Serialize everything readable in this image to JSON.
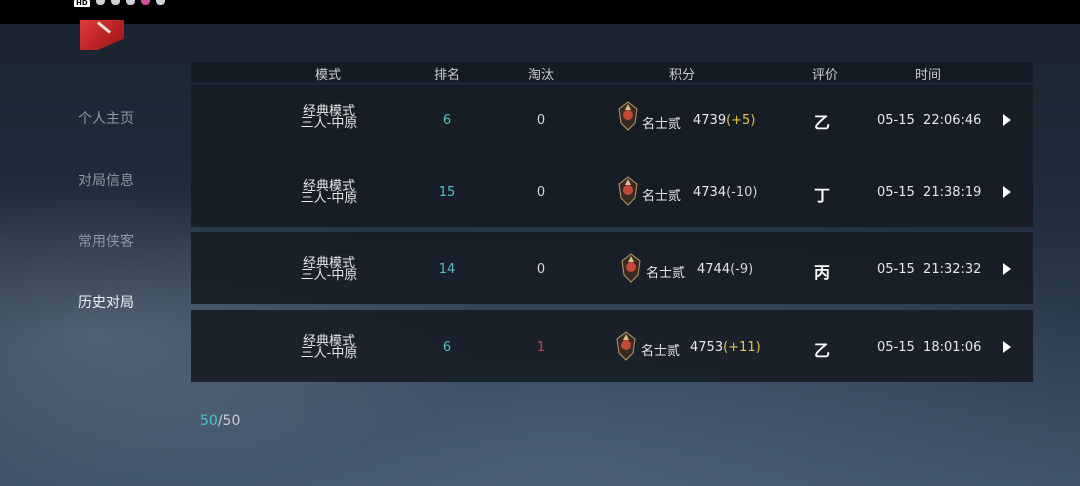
{
  "sidebar": {
    "items": [
      {
        "label": "个人主页",
        "active": false
      },
      {
        "label": "对局信息",
        "active": false
      },
      {
        "label": "常用侠客",
        "active": false
      },
      {
        "label": "历史对局",
        "active": true
      }
    ]
  },
  "table": {
    "headers": {
      "mode": "模式",
      "rank": "排名",
      "eliminations": "淘汰",
      "points": "积分",
      "rating": "评价",
      "time": "时间"
    },
    "rows": [
      {
        "mode_line1": "经典模式",
        "mode_line2": "三人-中原",
        "rank": "6",
        "eliminations": "0",
        "elim_highlight": false,
        "rank_title": "名士贰",
        "score": "4739",
        "delta": "(+5)",
        "delta_sign": "pos",
        "grade": "乙",
        "date": "05-15",
        "clock": "22:06:46"
      },
      {
        "mode_line1": "经典模式",
        "mode_line2": "三人-中原",
        "rank": "15",
        "eliminations": "0",
        "elim_highlight": false,
        "rank_title": "名士贰",
        "score": "4734",
        "delta": "(-10)",
        "delta_sign": "neg",
        "grade": "丁",
        "date": "05-15",
        "clock": "21:38:19"
      },
      {
        "mode_line1": "经典模式",
        "mode_line2": "三人-中原",
        "rank": "14",
        "eliminations": "0",
        "elim_highlight": false,
        "rank_title": "名士贰",
        "score": "4744",
        "delta": "(-9)",
        "delta_sign": "neg",
        "grade": "丙",
        "date": "05-15",
        "clock": "21:32:32"
      },
      {
        "mode_line1": "经典模式",
        "mode_line2": "三人-中原",
        "rank": "6",
        "eliminations": "1",
        "elim_highlight": true,
        "rank_title": "名士贰",
        "score": "4753",
        "delta": "(+11)",
        "delta_sign": "pos",
        "grade": "乙",
        "date": "05-15",
        "clock": "18:01:06"
      }
    ]
  },
  "pager": {
    "current": "50",
    "separator": "/",
    "total": "50"
  },
  "colors": {
    "accent": "#4fc2c8",
    "positive": "#e3c44a",
    "highlight_red": "#d23a50",
    "brand_red": "#d8282c"
  },
  "icons": {
    "rank_badge": "rank-badge-icon",
    "row_arrow": "play-arrow-icon",
    "logo": "game-logo-icon"
  }
}
